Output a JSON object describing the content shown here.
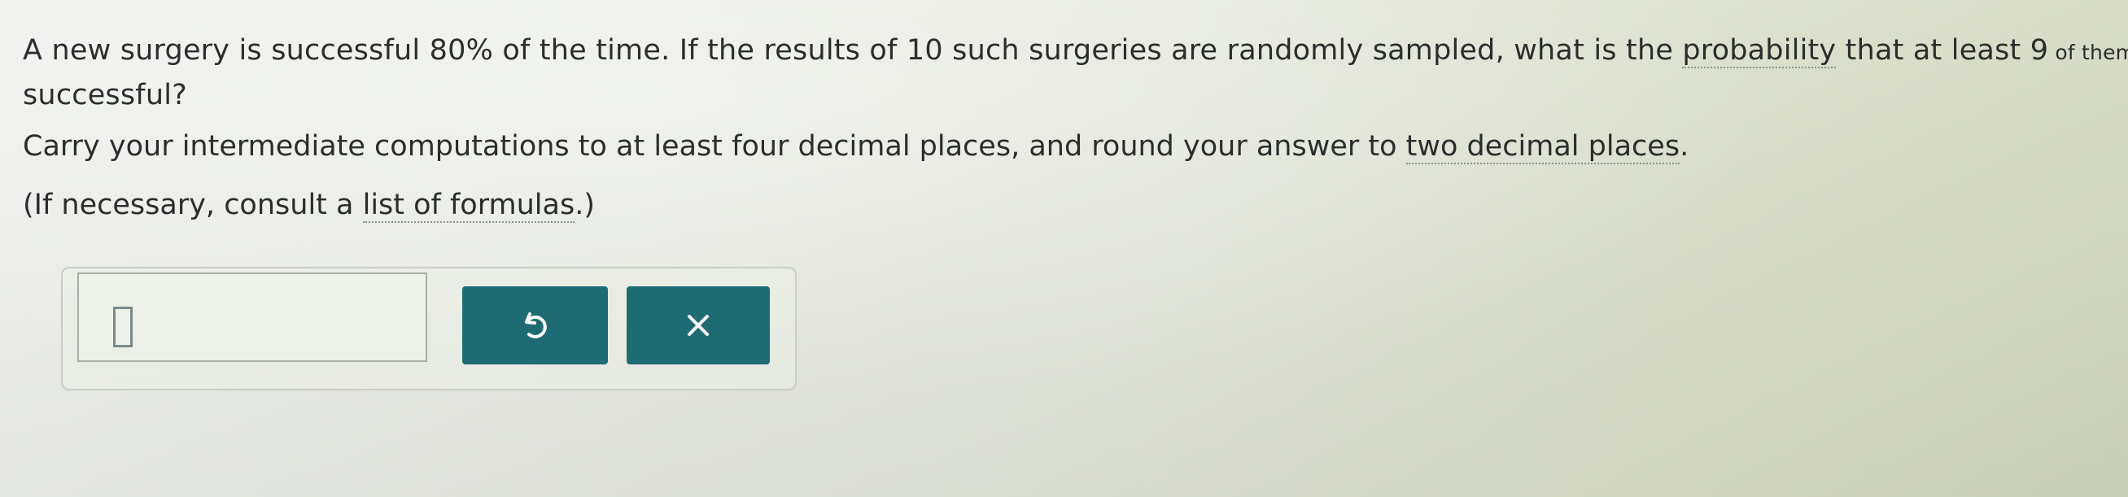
{
  "question": {
    "part1": "A new surgery is successful 80% of the time. If the results of 10 such surgeries are randomly sampled, what is the ",
    "probability_link": "probability",
    "part2": " that at least 9",
    "part3_small": " of them are",
    "line2": "successful?"
  },
  "instruction": {
    "text": "Carry your intermediate computations to at least four decimal places, and round your answer to ",
    "link": "two decimal places",
    "end": "."
  },
  "formulas": {
    "prefix": "(If necessary, consult a ",
    "link": "list of formulas",
    "suffix": ".)"
  },
  "answer": {
    "value": ""
  },
  "buttons": {
    "undo_icon": "undo-icon",
    "clear_icon": "close-icon"
  },
  "colors": {
    "button_bg": "#1f6b74",
    "text": "#2b2e2c"
  }
}
